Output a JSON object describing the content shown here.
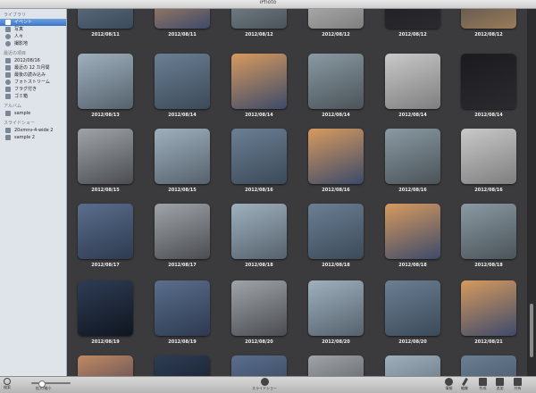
{
  "window": {
    "title": "iPhoto"
  },
  "sidebar": {
    "sections": [
      {
        "label": "ライブラリ",
        "items": [
          {
            "label": "イベント",
            "icon": "events-icon",
            "selected": true
          },
          {
            "label": "写真",
            "icon": "photos-icon"
          },
          {
            "label": "人々",
            "icon": "faces-icon"
          },
          {
            "label": "撮影地",
            "icon": "places-icon"
          }
        ]
      },
      {
        "label": "最近の項目",
        "items": [
          {
            "label": "2012/08/16",
            "icon": "calendar-icon"
          },
          {
            "label": "最近の 12 カ月間",
            "icon": "calendar-icon"
          },
          {
            "label": "最後の読み込み",
            "icon": "import-icon"
          },
          {
            "label": "フォトストリーム",
            "icon": "photostream-icon"
          },
          {
            "label": "フラグ付き",
            "icon": "flag-icon"
          },
          {
            "label": "ゴミ箱",
            "icon": "trash-icon"
          }
        ]
      },
      {
        "label": "アルバム",
        "items": [
          {
            "label": "sample",
            "icon": "album-icon"
          }
        ]
      },
      {
        "label": "スライドショー",
        "items": [
          {
            "label": "20xmnv-4-wide 2",
            "icon": "slideshow-icon"
          },
          {
            "label": "sample 2",
            "icon": "slideshow-icon"
          }
        ]
      }
    ]
  },
  "grid": {
    "rows": [
      [
        "2012/08/11",
        "2012/08/11",
        "2012/08/12",
        "2012/08/12",
        "2012/08/12",
        "2012/08/12"
      ],
      [
        "2012/08/13",
        "2012/08/14",
        "2012/08/14",
        "2012/08/14",
        "2012/08/14",
        "2012/08/14"
      ],
      [
        "2012/08/15",
        "2012/08/15",
        "2012/08/16",
        "2012/08/16",
        "2012/08/16",
        "2012/08/16"
      ],
      [
        "2012/08/17",
        "2012/08/17",
        "2012/08/18",
        "2012/08/18",
        "2012/08/18",
        "2012/08/18"
      ],
      [
        "2012/08/19",
        "2012/08/19",
        "2012/08/20",
        "2012/08/20",
        "2012/08/20",
        "2012/08/21"
      ],
      [
        "",
        "",
        "",
        "",
        "",
        ""
      ]
    ]
  },
  "toolbar": {
    "search": "検索",
    "zoom": "拡大/縮小",
    "slideshow": "スライドショー",
    "info": "情報",
    "edit": "編集",
    "create": "作成",
    "add": "追加",
    "share": "共有"
  }
}
